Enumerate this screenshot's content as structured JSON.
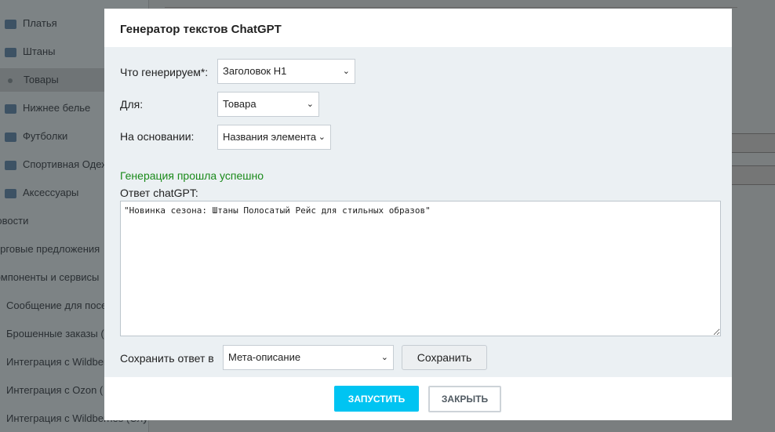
{
  "sidebar": {
    "items": [
      {
        "label": "Платья",
        "type": "folder"
      },
      {
        "label": "Штаны",
        "type": "folder"
      },
      {
        "label": "Товары",
        "type": "dot"
      },
      {
        "label": "Нижнее белье",
        "type": "folder"
      },
      {
        "label": "Футболки",
        "type": "folder"
      },
      {
        "label": "Спортивная Одежда",
        "type": "folder"
      },
      {
        "label": "Аксессуары",
        "type": "folder"
      },
      {
        "label": "Новости",
        "type": "plain"
      },
      {
        "label": "Торговые предложения",
        "type": "plain"
      },
      {
        "label": "Компоненты и сервисы",
        "type": "plain"
      },
      {
        "label": "Сообщение для посетителей",
        "type": "sub"
      },
      {
        "label": "Брошенные заказы (",
        "type": "sub"
      },
      {
        "label": "Интеграция с Wildberries",
        "type": "sub"
      },
      {
        "label": "Интеграция с Ozon (",
        "type": "sub"
      },
      {
        "label": "Интеграция с Wildberries (Слу",
        "type": "sub"
      }
    ]
  },
  "dialog": {
    "title": "Генератор текстов ChatGPT",
    "what_label": "Что генерируем*:",
    "what_value": "Заголовок H1",
    "for_label": "Для:",
    "for_value": "Товара",
    "basis_label": "На основании:",
    "basis_value": "Названия элемента",
    "status": "Генерация прошла успешно",
    "status_color": "#1a8a1a",
    "answer_label": "Ответ chatGPT:",
    "answer_value": "\"Новинка сезона: Штаны Полосатый Рейс для стильных образов\"",
    "save_to_label": "Сохранить ответ в",
    "save_to_value": "Мета-описание",
    "save_button": "Сохранить",
    "run_button": "ЗАПУСТИТЬ",
    "close_button": "ЗАКРЫТЬ",
    "accent": "#00c4f2"
  }
}
